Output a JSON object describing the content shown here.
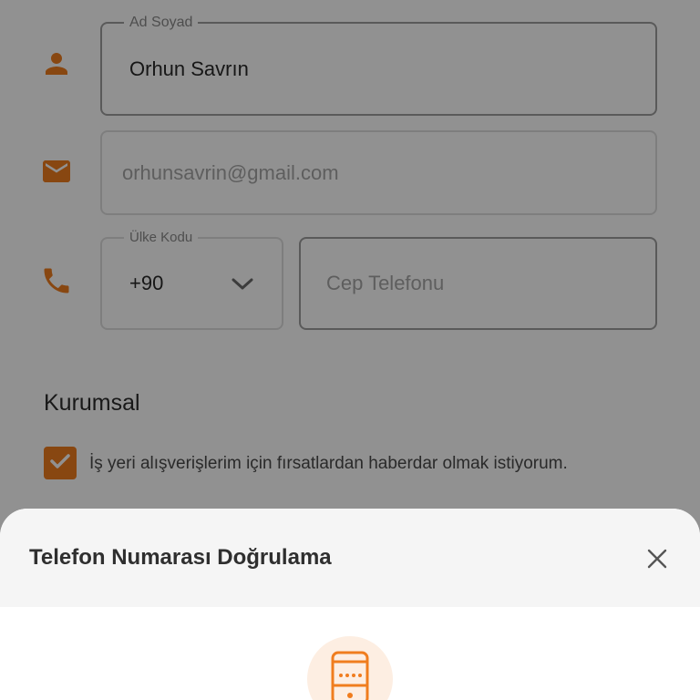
{
  "form": {
    "name": {
      "legend": "Ad Soyad",
      "value": "Orhun Savrın"
    },
    "email": {
      "placeholder": "orhunsavrin@gmail.com"
    },
    "country_code": {
      "legend": "Ülke Kodu",
      "value": "+90"
    },
    "phone": {
      "placeholder": "Cep Telefonu"
    }
  },
  "corporate": {
    "title": "Kurumsal",
    "checkbox_label": "İş yeri alışverişlerim için fırsatlardan haberdar olmak istiyorum.",
    "checked": true
  },
  "sheet": {
    "title": "Telefon Numarası Doğrulama"
  },
  "icons": {
    "name_row": "person-icon",
    "email_row": "mail-icon",
    "phone_row": "phone-icon",
    "dropdown": "chevron-down-icon",
    "close": "close-icon",
    "illustration": "phone-password-icon"
  },
  "colors": {
    "accent": "#F07D1E",
    "accent_light": "#FDEEE2",
    "sheet_header": "#F5F5F5",
    "overlay": "rgba(0,0,0,0.43)"
  }
}
